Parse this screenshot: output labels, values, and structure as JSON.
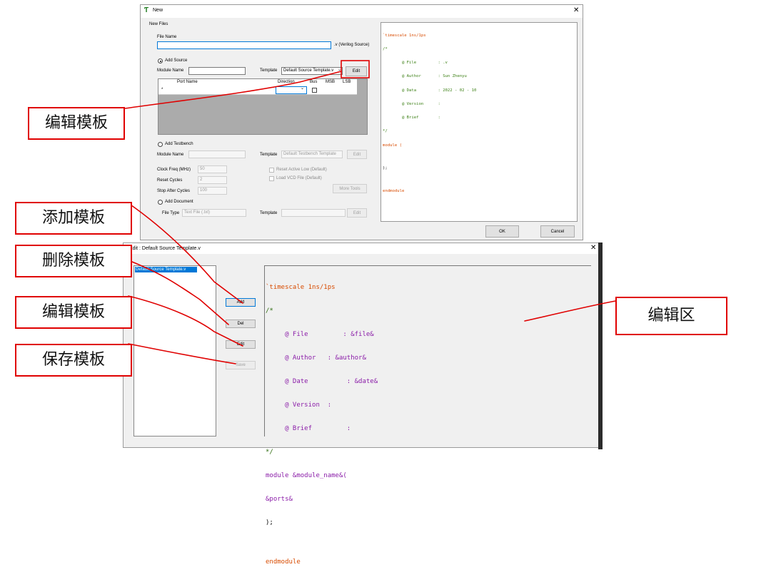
{
  "new_dialog": {
    "title": "New",
    "close_glyph": "✕",
    "group_label": "New Files",
    "file_name_label": "File Name",
    "file_name_value": "",
    "file_suffix": ".v (Verilog Source)",
    "add_source_label": "Add Source",
    "module_name_label": "Module Name",
    "module_name_value": "",
    "template_label": "Template",
    "template_value": "Default Source Template.v",
    "edit_button": "Edit",
    "port_table": {
      "columns": [
        "Port Name",
        "Direction",
        "Bus",
        "MSB",
        "LSB"
      ],
      "row_marker": "*"
    },
    "add_testbench_label": "Add Testbench",
    "tb_module_name_label": "Module Name",
    "tb_template_label": "Template",
    "tb_template_value": "Default Testbench Template",
    "tb_edit_button": "Edit",
    "clock_freq_label": "Clock Freq (MHz)",
    "clock_freq_value": "50",
    "reset_cycles_label": "Reset Cycles",
    "reset_cycles_value": "2",
    "stop_after_label": "Stop After Cycles",
    "stop_after_value": "100",
    "reset_active_low_label": "Reset Active Low (Default)",
    "load_vcd_label": "Load VCD File (Default)",
    "more_tools_button": "More Tools",
    "add_document_label": "Add Document",
    "file_type_label": "File Type",
    "file_type_value": "Text File (.txt)",
    "doc_template_label": "Template",
    "doc_edit_button": "Edit",
    "ok_button": "OK",
    "cancel_button": "Cancel",
    "preview_lines": [
      "`timescale 1ns/1ps",
      "/*",
      "        @ File         : .v",
      "        @ Author       : Sun Zhenyu",
      "        @ Data         : 2022 - 02 - 10",
      "        @ Version      :",
      "        @ Brief        :",
      "*/",
      "module (",
      "",
      ");",
      "",
      "endmodule"
    ]
  },
  "edit_dialog": {
    "title": "Edit : Default Source Template.v",
    "close_glyph": "✕",
    "list_items": [
      "Default Source Template.v"
    ],
    "add_button": "Add",
    "del_button": "Del",
    "edit_button": "Edit",
    "save_button": "Save",
    "editor_lines": [
      "`timescale 1ns/1ps",
      "/*",
      "     @ File         : &file&",
      "     @ Author   : &author&",
      "     @ Date          : &date&",
      "     @ Version  :",
      "     @ Brief         :",
      "*/",
      "module &module_name&(",
      "&ports&",
      ");",
      "",
      "endmodule"
    ]
  },
  "callouts": {
    "edit_template_top": "编辑模板",
    "add_template": "添加模板",
    "delete_template": "删除模板",
    "edit_template": "编辑模板",
    "save_template": "保存模板",
    "edit_area": "编辑区"
  },
  "colors": {
    "annotation_red": "#e00000",
    "keyword_orange": "#d84b00",
    "macro_purple": "#8a1ca8",
    "comment_green": "#3b7f14",
    "selection_blue": "#0078d7"
  }
}
